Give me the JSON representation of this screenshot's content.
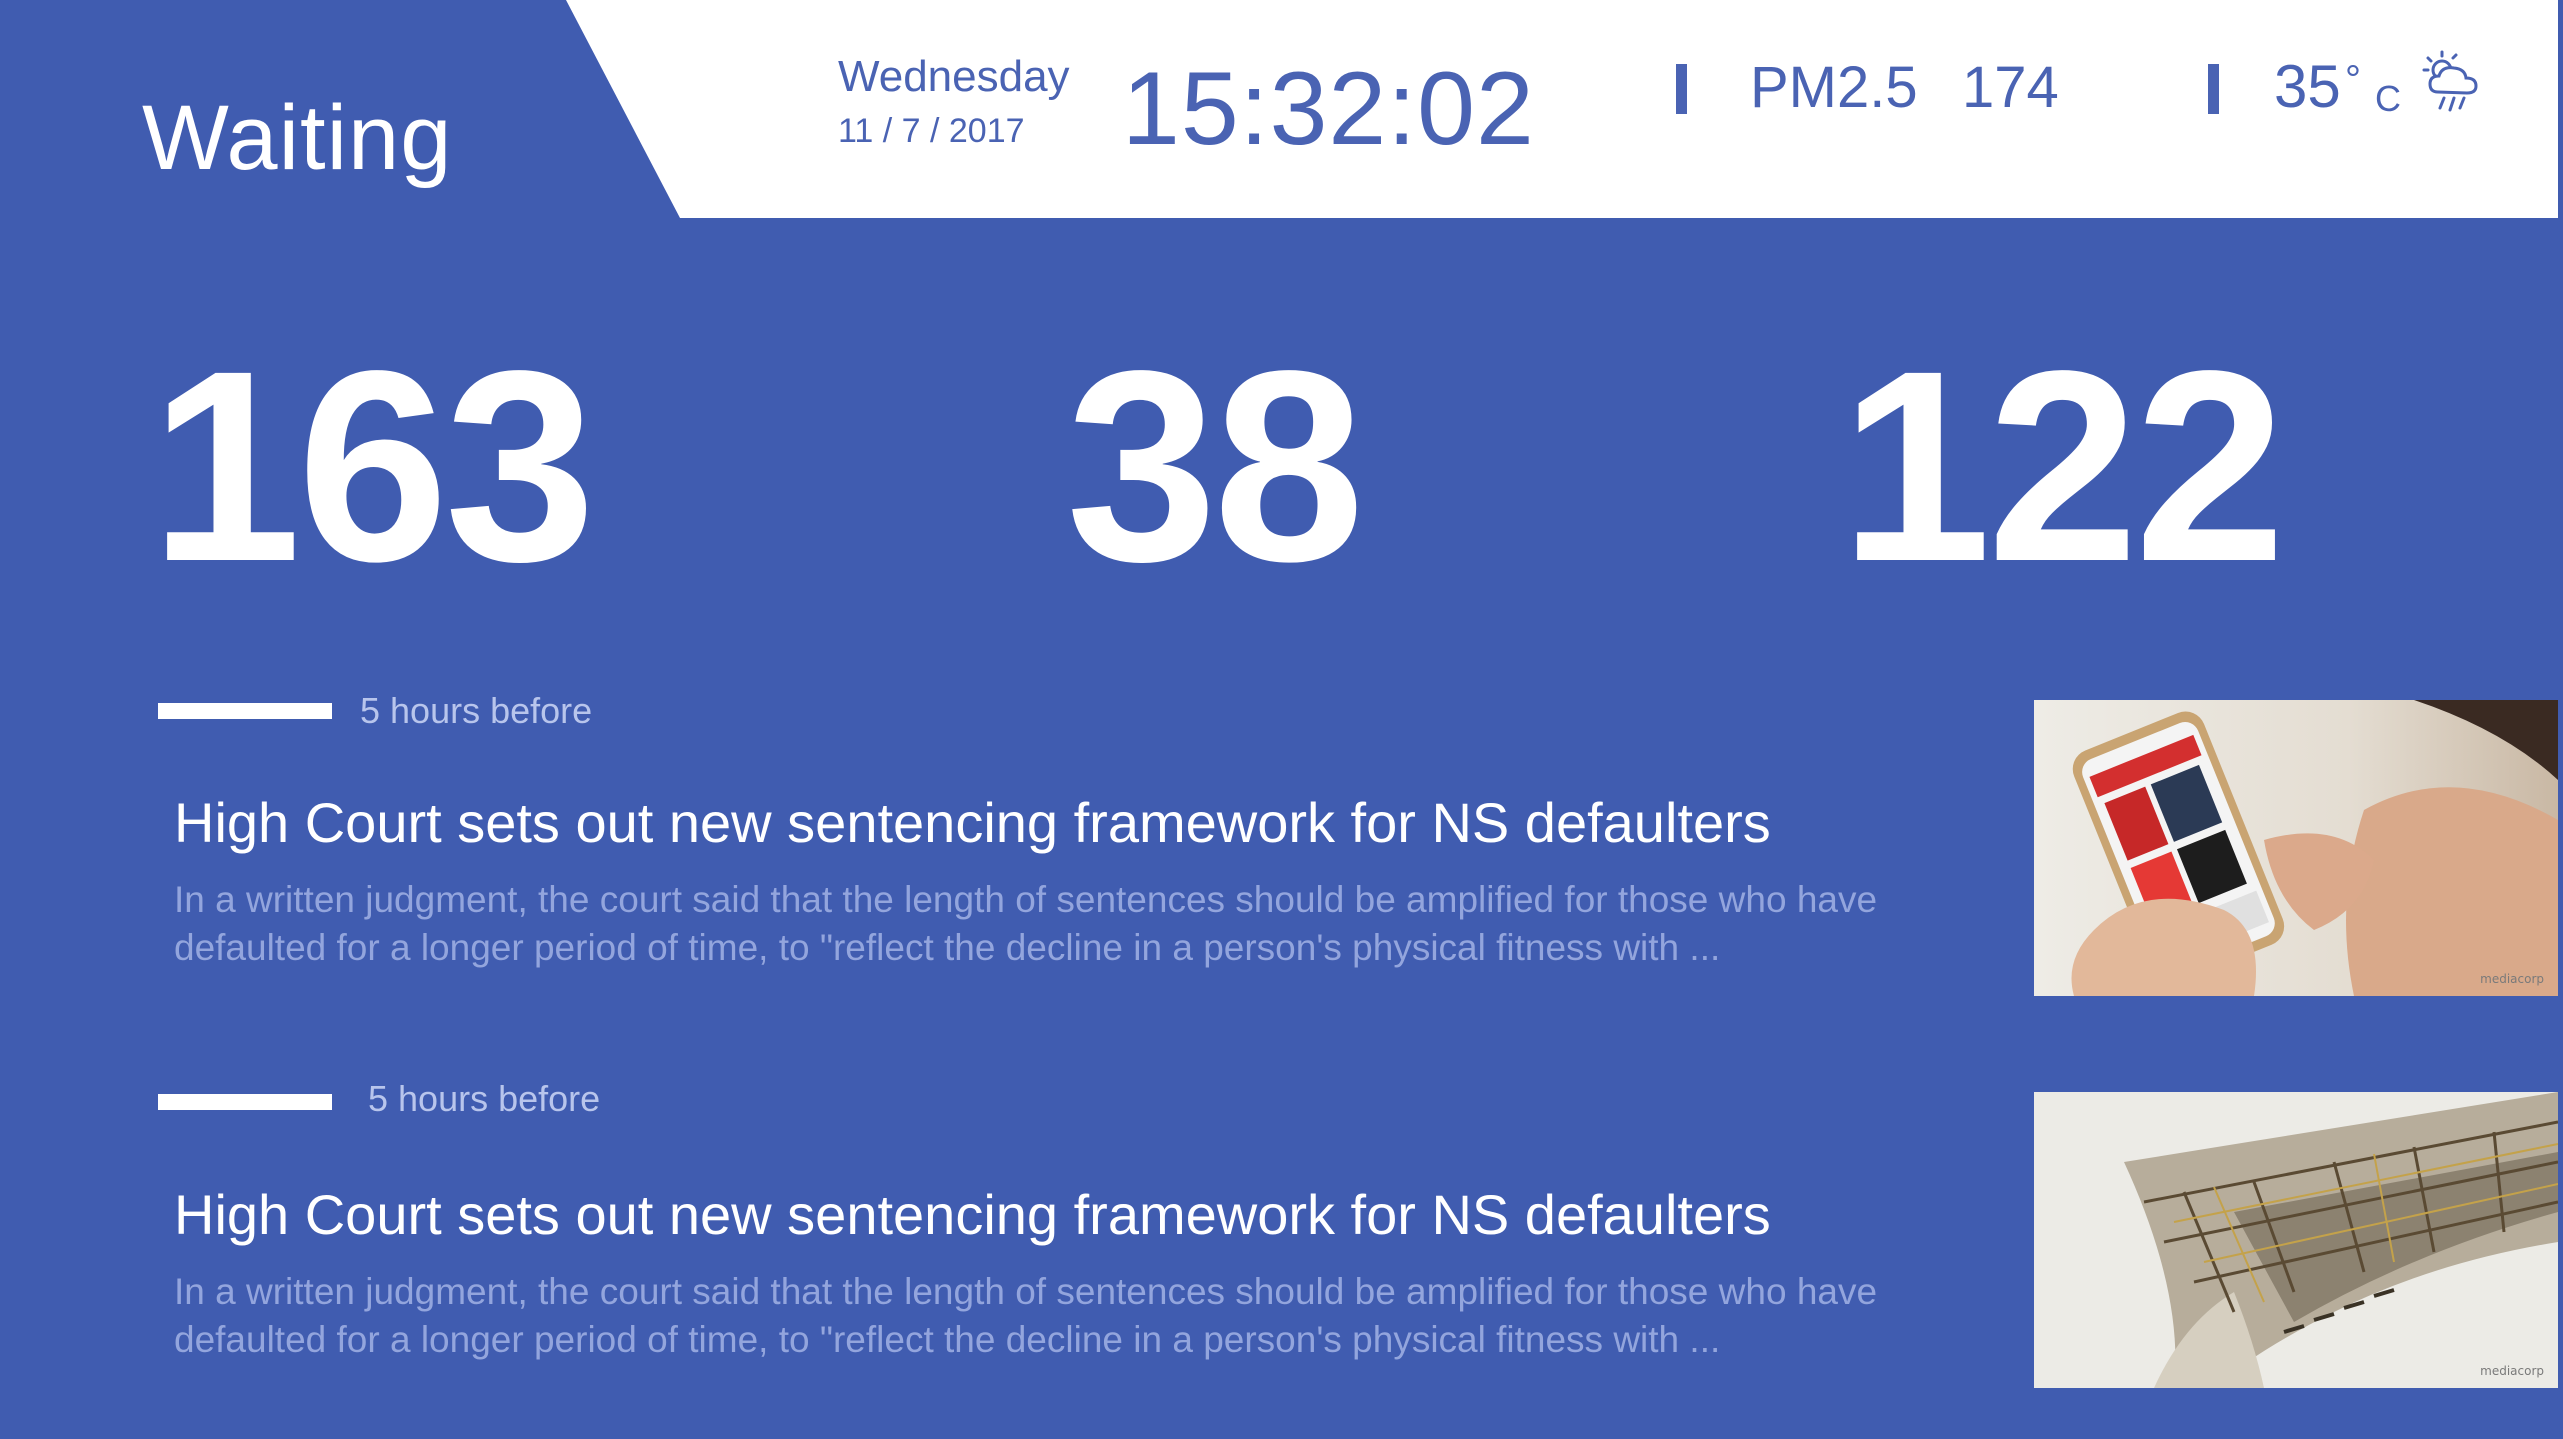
{
  "header": {
    "title": "Waiting",
    "day": "Wednesday",
    "date": "11 / 7 / 2017",
    "time": "15:32:02",
    "pm_label": "PM2.5",
    "pm_value": "174",
    "temperature": "35",
    "degree_symbol": "°",
    "temperature_unit": "C",
    "weather_icon": "cloud-rain-sun-icon"
  },
  "counts": [
    {
      "value": "163"
    },
    {
      "value": "38"
    },
    {
      "value": "122"
    }
  ],
  "news": [
    {
      "time": "5 hours before",
      "headline": "High Court sets out new sentencing framework for NS defaulters",
      "summary": "In a written judgment, the court said that the length of sentences should be amplified for those who have defaulted for a longer period of time, to \"reflect the decline in a person's physical fitness with ...",
      "thumbnail": "phone-reading-photo",
      "thumbnail_logo": "mediacorp"
    },
    {
      "time": "5 hours before",
      "headline": "High Court sets out new sentencing framework for NS defaulters",
      "summary": "In a written judgment, the court said that the length of sentences should be amplified for those who have defaulted for a longer period of time, to \"reflect the decline in a person's physical fitness with ...",
      "thumbnail": "collapsed-scaffolding-photo",
      "thumbnail_logo": "mediacorp"
    }
  ],
  "colors": {
    "background": "#405cb0",
    "header_bg": "#ffffff",
    "accent_text": "#4a63b3",
    "summary_text": "#93a5dd",
    "time_text": "#b8c5ec"
  }
}
